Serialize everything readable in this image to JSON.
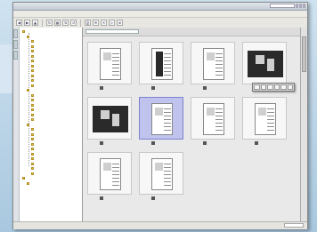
{
  "window": {
    "title": "",
    "right_info": "",
    "search_text": ""
  },
  "menu": [],
  "toolbar_icons": [
    "back-icon",
    "forward-icon",
    "up-icon",
    "refresh-icon",
    "view-icon",
    "sort-icon",
    "rotate-icon",
    "print-icon",
    "mail-icon",
    "delete-icon",
    "slideshow-icon",
    "zoom-icon"
  ],
  "tree": {
    "items": [
      {
        "depth": 0,
        "label": ""
      },
      {
        "depth": 1,
        "label": ""
      },
      {
        "depth": 2,
        "label": ""
      },
      {
        "depth": 2,
        "label": ""
      },
      {
        "depth": 2,
        "label": ""
      },
      {
        "depth": 2,
        "label": ""
      },
      {
        "depth": 2,
        "label": ""
      },
      {
        "depth": 2,
        "label": ""
      },
      {
        "depth": 2,
        "label": ""
      },
      {
        "depth": 2,
        "label": ""
      },
      {
        "depth": 2,
        "label": ""
      },
      {
        "depth": 2,
        "label": ""
      },
      {
        "depth": 1,
        "label": ""
      },
      {
        "depth": 2,
        "label": ""
      },
      {
        "depth": 2,
        "label": ""
      },
      {
        "depth": 2,
        "label": ""
      },
      {
        "depth": 2,
        "label": ""
      },
      {
        "depth": 2,
        "label": ""
      },
      {
        "depth": 2,
        "label": ""
      },
      {
        "depth": 1,
        "label": ""
      },
      {
        "depth": 2,
        "label": ""
      },
      {
        "depth": 2,
        "label": ""
      },
      {
        "depth": 2,
        "label": ""
      },
      {
        "depth": 2,
        "label": ""
      },
      {
        "depth": 2,
        "label": ""
      },
      {
        "depth": 2,
        "label": ""
      },
      {
        "depth": 2,
        "label": ""
      },
      {
        "depth": 2,
        "label": ""
      },
      {
        "depth": 2,
        "label": ""
      },
      {
        "depth": 2,
        "label": ""
      },
      {
        "depth": 0,
        "label": ""
      },
      {
        "depth": 1,
        "label": ""
      }
    ]
  },
  "content": {
    "path": "",
    "sort_label": ""
  },
  "thumbnails": [
    {
      "caption": "",
      "meta": "",
      "kind": "document",
      "selected": false
    },
    {
      "caption": "",
      "meta": "",
      "kind": "document-dark",
      "selected": false
    },
    {
      "caption": "",
      "meta": "",
      "kind": "document",
      "selected": false
    },
    {
      "caption": "",
      "meta": "",
      "kind": "photo-dark",
      "selected": false
    },
    {
      "caption": "",
      "meta": "",
      "kind": "photo-dark",
      "selected": false
    },
    {
      "caption": "",
      "meta": "",
      "kind": "document",
      "selected": true
    },
    {
      "caption": "",
      "meta": "",
      "kind": "document",
      "selected": false
    },
    {
      "caption": "",
      "meta": "",
      "kind": "document",
      "selected": false
    },
    {
      "caption": "",
      "meta": "",
      "kind": "document",
      "selected": false
    },
    {
      "caption": "",
      "meta": "",
      "kind": "document",
      "selected": false
    }
  ],
  "status": {
    "left": "",
    "right": ""
  },
  "colors": {
    "selection": "#bfc3ee",
    "folder": "#e8c54a",
    "backdrop": "#b9d3e6"
  }
}
